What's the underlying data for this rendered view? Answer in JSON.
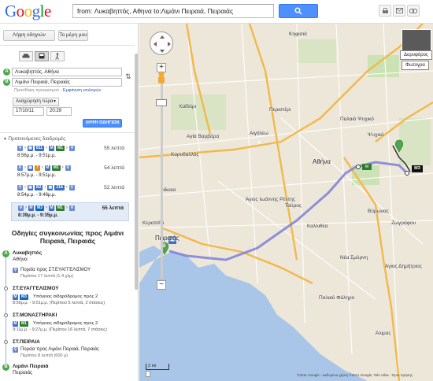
{
  "header": {
    "logo": "Google",
    "search_value": "from: Λυκαβηττός, Αθηνα   to:Λιμάνι Πειραιά, Πειραιάς"
  },
  "sidebar": {
    "get_directions_btn": "Λήψη οδηγιών",
    "my_maps_btn": "Το μέρη μου",
    "from_value": "Λυκαβηττός, Αθήνα",
    "to_value": "Λιμάνι Πειραιά, Πειραιάς",
    "add_dest": "Προσθήκη προορισμού",
    "show_options": "Εμφάνιση επιλογών",
    "depart_select": "Αναχώρηση τώρα",
    "date_value": "17/10/11",
    "time_value": "20:29",
    "submit_btn": "ΛΗΨΗ ΟΔΗΓΙΩΝ",
    "suggested": "Προτεινόμενες διαδρομές",
    "routes": [
      {
        "lines": [
          "811",
          "M1"
        ],
        "times": "8:56μ.μ. - 9:51μ.μ.",
        "duration": "55 λεπτά"
      },
      {
        "lines": [
          "7",
          "M1"
        ],
        "times": "8:57μ.μ. - 9:51μ.μ.",
        "duration": "54 λεπτά"
      },
      {
        "lines": [
          "B2",
          "218"
        ],
        "times": "8:54μ.μ. - 9:46μ.μ.",
        "duration": "52 λεπτά"
      },
      {
        "lines": [
          "M3",
          "M1"
        ],
        "times": "8:39μ.μ. - 9:35μ.μ.",
        "duration": "55 λεπτά"
      }
    ],
    "transit_title": "Οδηγίες συγκοινωνίας προς Λιμάνι Πειραιά, Πειραιάς",
    "start_name": "Λυκαβηττός",
    "start_sub": "Αθήνα",
    "walk1": "Πορεία προς ΣΤ.ΕΥΑΓΓΕΛΙΣΜΟΥ",
    "walk1_sub": "Περίπου 17 λεπτά (1.4 χλμ)",
    "st1": "ΣΤ.ΕΥΑΓΓΕΛΙΣΜΟΥ",
    "st1_line": "M3",
    "st1_desc": "Υπόγειος σιδηρόδρομος προς 2",
    "st1_time": "8:56μ.μ. - 9:01μ.μ. (Περίπου 5 λεπτά, 2 στάσεις)",
    "st2": "ΣΤ.ΜΟΝΑΣΤΗΡΑΚΙ",
    "st2_line": "M1",
    "st2_desc": "Υπόγειος σιδηρόδρομος προς 2",
    "st2_time": "9:11μ.μ. - 9:27μ.μ. (Περίπου 16 λεπτά, 7 στάσεις)",
    "st3": "ΣΤ.ΠΕΙΡΑΙΑ",
    "walk2": "Πορεία προς Λιμάνι Πειραιά, Πειραιάς",
    "walk2_sub": "Περίπου 8 λεπτά (600 μ)",
    "end_name": "Λιμάνι Πειραιά",
    "end_sub": "Πειραιάς"
  },
  "map": {
    "labels": [
      "Κηφισιά",
      "Παλαιό Ψυχικό",
      "Ψυχικό",
      "Περιστέρι",
      "Αιγάλεω",
      "Αγία Βαρβάρα",
      "Κορυδαλλός",
      "Χαϊδάρι",
      "Νίκαια",
      "Αθήνα",
      "Βύρωνας",
      "Καλλιθέα",
      "Νέα Σμύρνη",
      "Άγιος Δημήτριος",
      "Παλαιό Φάληρο",
      "Άλιμος",
      "Πειραιάς",
      "Άγιος Ιωάννης Ρέντης",
      "Ταύρος",
      "Ζωγράφου",
      "Κερατσίνι"
    ],
    "satellite_btn": "Δορυφόρος",
    "photos_btn": "Φωτογρα",
    "scale": "2 mi",
    "copyright": "©2011 Google - Δεδομένα χάρτη ©2011 Google, Tele Atlas - Όροι Χρήσης",
    "line_label": "M3"
  },
  "colors": {
    "route": "#7b7fd8",
    "highway": "#f2b84b",
    "metro_m1": "#2f7d32",
    "metro_m3": "#1565c0",
    "pin": "#4ca64c",
    "sea": "#a9c6e8"
  }
}
